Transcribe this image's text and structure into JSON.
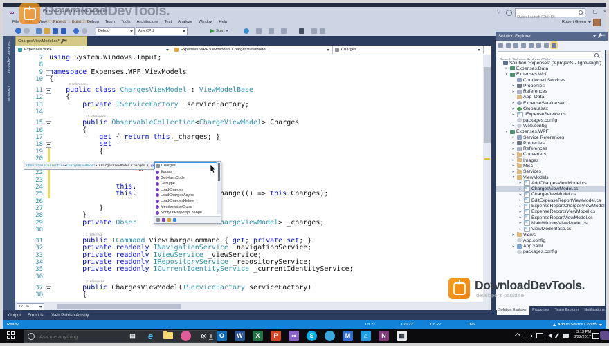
{
  "colors": {
    "accent_blue": "#1282d8",
    "keyword_blue": "#0009e8",
    "type_teal": "#2b91af",
    "tab_active": "#d6c887",
    "watermark_orange": "#f5941d"
  },
  "icons": {
    "minimize": "–",
    "restore": "▢",
    "close": "×",
    "filter": "▽",
    "vs_logo": "∞",
    "chevron_down": "▾"
  },
  "watermark": {
    "brand": "DownloadDevTools.",
    "tagline": "developer's paradise"
  },
  "titlebar": {
    "title": "Expenses - Microsoft Visual Studio",
    "quick_launch_placeholder": "Quick Launch (Ctrl+Q)",
    "user": "Robert Green"
  },
  "menubar": {
    "items": [
      "File",
      "Edit",
      "View",
      "Project",
      "Build",
      "Debug",
      "Team",
      "Tools",
      "Architecture",
      "Test",
      "Analyze",
      "Window",
      "Help"
    ]
  },
  "toolbar": {
    "debug_target": "Debug",
    "platform": "Any CPU",
    "start_label": "Start"
  },
  "left_strip": {
    "tabs": [
      "Server Explorer",
      "Toolbox"
    ]
  },
  "editor": {
    "tab": {
      "label": "ChargesViewModel.cs*"
    },
    "navbar": {
      "project": "Expenses.WPF",
      "type_path": "Expenses.WPF.ViewModels.ChargesViewModel",
      "member": "Charges"
    },
    "zoom_level": "121 %",
    "lines": [
      {
        "n": 7,
        "ind": 0,
        "tk": [
          [
            "k",
            "using"
          ],
          [
            "p",
            " System.Windows.Input;"
          ]
        ]
      },
      {
        "n": 8,
        "ind": 0,
        "tk": []
      },
      {
        "n": 9,
        "ind": 0,
        "fold": true,
        "tk": [
          [
            "k",
            "namespace"
          ],
          [
            "p",
            " Expenses.WPF.ViewModels"
          ]
        ]
      },
      {
        "n": 10,
        "ind": 0,
        "tk": [
          [
            "p",
            "{"
          ]
        ]
      },
      {
        "n": 11,
        "ind": 4,
        "fold": true,
        "lens": "5 references",
        "tk": [
          [
            "k",
            "public"
          ],
          [
            "p",
            " "
          ],
          [
            "k",
            "class"
          ],
          [
            "p",
            " "
          ],
          [
            "t",
            "ChargesViewModel"
          ],
          [
            "p",
            " : "
          ],
          [
            "t",
            "ViewModelBase"
          ]
        ]
      },
      {
        "n": 12,
        "ind": 4,
        "tk": [
          [
            "p",
            "{"
          ]
        ]
      },
      {
        "n": 13,
        "ind": 8,
        "tk": [
          [
            "k",
            "private"
          ],
          [
            "p",
            " "
          ],
          [
            "t",
            "IServiceFactory"
          ],
          [
            "p",
            " _serviceFactory;"
          ]
        ]
      },
      {
        "n": 14,
        "ind": 8,
        "tk": []
      },
      {
        "n": 15,
        "ind": 8,
        "fold": true,
        "lens": "11 references",
        "tk": [
          [
            "k",
            "public"
          ],
          [
            "p",
            " "
          ],
          [
            "t",
            "ObservableCollection"
          ],
          [
            "p",
            "<"
          ],
          [
            "t",
            "ChargeViewModel"
          ],
          [
            "p",
            "> Charges"
          ]
        ]
      },
      {
        "n": 16,
        "ind": 8,
        "tk": [
          [
            "p",
            "{"
          ]
        ]
      },
      {
        "n": 17,
        "ind": 12,
        "tk": [
          [
            "k",
            "get"
          ],
          [
            "p",
            " { "
          ],
          [
            "k",
            "return"
          ],
          [
            "p",
            " "
          ],
          [
            "k",
            "this"
          ],
          [
            "p",
            "._charges; }"
          ]
        ]
      },
      {
        "n": 18,
        "ind": 12,
        "fold": true,
        "tk": [
          [
            "k",
            "set"
          ]
        ]
      },
      {
        "n": 19,
        "ind": 12,
        "chg": true,
        "tk": [
          [
            "p",
            "{"
          ]
        ]
      },
      {
        "n": 20,
        "ind": 12,
        "chg": true,
        "tk": []
      },
      {
        "n": 21,
        "ind": 16,
        "chg": true,
        "caret": true,
        "tk": [
          [
            "k",
            "this"
          ],
          [
            "p",
            "."
          ]
        ]
      },
      {
        "n": 22,
        "ind": 16,
        "chg": true,
        "tk": []
      },
      {
        "n": 23,
        "ind": 16,
        "chg": true,
        "tk": []
      },
      {
        "n": 24,
        "ind": 16,
        "chg": true,
        "tk": [
          [
            "k",
            "this"
          ],
          [
            "p",
            "."
          ]
        ]
      },
      {
        "n": 25,
        "ind": 16,
        "chg": true,
        "tk": [
          [
            "k",
            "this"
          ],
          [
            "p",
            "."
          ],
          [
            "g",
            19
          ],
          [
            "p",
            "Change(() => "
          ],
          [
            "k",
            "this"
          ],
          [
            "p",
            ".Charges);"
          ]
        ]
      },
      {
        "n": 26,
        "ind": 16,
        "tk": []
      },
      {
        "n": 27,
        "ind": 12,
        "tk": [
          [
            "p",
            "}"
          ]
        ]
      },
      {
        "n": 28,
        "ind": 8,
        "tk": [
          [
            "p",
            "}"
          ]
        ]
      },
      {
        "n": 29,
        "ind": 8,
        "tk": [
          [
            "k",
            "private"
          ],
          [
            "p",
            " "
          ],
          [
            "t",
            "Obser"
          ],
          [
            "g",
            19
          ],
          [
            "t",
            "ChargeViewModel"
          ],
          [
            "p",
            "> _charges;"
          ]
        ]
      },
      {
        "n": 30,
        "ind": 8,
        "tk": []
      },
      {
        "n": 31,
        "ind": 8,
        "lens": "1 reference",
        "tk": [
          [
            "k",
            "public"
          ],
          [
            "p",
            " "
          ],
          [
            "t",
            "ICommand"
          ],
          [
            "p",
            " ViewChargeCommand { "
          ],
          [
            "k",
            "get"
          ],
          [
            "p",
            "; "
          ],
          [
            "k",
            "private"
          ],
          [
            "p",
            " "
          ],
          [
            "k",
            "set"
          ],
          [
            "p",
            "; }"
          ]
        ]
      },
      {
        "n": 32,
        "ind": 8,
        "tk": [
          [
            "k",
            "private"
          ],
          [
            "p",
            " "
          ],
          [
            "k",
            "readonly"
          ],
          [
            "p",
            " "
          ],
          [
            "t",
            "INavigationService"
          ],
          [
            "p",
            " _navigationService;"
          ]
        ]
      },
      {
        "n": 33,
        "ind": 8,
        "tk": [
          [
            "k",
            "private"
          ],
          [
            "p",
            " "
          ],
          [
            "k",
            "readonly"
          ],
          [
            "p",
            " "
          ],
          [
            "t",
            "IViewService"
          ],
          [
            "p",
            " _viewService;"
          ]
        ]
      },
      {
        "n": 34,
        "ind": 8,
        "tk": [
          [
            "k",
            "private"
          ],
          [
            "p",
            " "
          ],
          [
            "k",
            "readonly"
          ],
          [
            "p",
            " "
          ],
          [
            "t",
            "IRepositoryService"
          ],
          [
            "p",
            " _repositoryService;"
          ]
        ]
      },
      {
        "n": 35,
        "ind": 8,
        "tk": [
          [
            "k",
            "private"
          ],
          [
            "p",
            " "
          ],
          [
            "k",
            "readonly"
          ],
          [
            "p",
            " "
          ],
          [
            "t",
            "ICurrentIdentityService"
          ],
          [
            "p",
            " _currentIdentityService;"
          ]
        ]
      },
      {
        "n": 36,
        "ind": 8,
        "tk": []
      },
      {
        "n": 37,
        "ind": 8,
        "fold": true,
        "lens": "3 references",
        "tk": [
          [
            "k",
            "public"
          ],
          [
            "p",
            " ChargesViewModel("
          ],
          [
            "t",
            "IServiceFactory"
          ],
          [
            "p",
            " serviceFactory)"
          ]
        ]
      },
      {
        "n": 38,
        "ind": 8,
        "tk": [
          [
            "p",
            "{"
          ]
        ]
      }
    ]
  },
  "tooltip": {
    "tk": [
      [
        "t",
        "ObservableCollection"
      ],
      [
        "p",
        "<"
      ],
      [
        "t",
        "ChargeViewModel"
      ],
      [
        "p",
        "> "
      ],
      [
        "p",
        "ChargesViewModel.Charges"
      ],
      [
        "p",
        " { "
      ],
      [
        "k",
        "get"
      ],
      [
        "p",
        "; "
      ],
      [
        "k",
        "set"
      ],
      [
        "p",
        "; }"
      ]
    ]
  },
  "intellisense": {
    "selected_index": 0,
    "items": [
      {
        "label": "Charges",
        "kind": "property"
      },
      {
        "label": "Equals",
        "kind": "method"
      },
      {
        "label": "GetHashCode",
        "kind": "method"
      },
      {
        "label": "GetType",
        "kind": "method"
      },
      {
        "label": "LoadCharges",
        "kind": "method"
      },
      {
        "label": "LoadChargesAsync",
        "kind": "method"
      },
      {
        "label": "LoadChargesHelper",
        "kind": "method"
      },
      {
        "label": "MemberwiseClone",
        "kind": "method"
      },
      {
        "label": "NotifyOfPropertyChange",
        "kind": "method"
      }
    ],
    "filter_icons": [
      "properties-filter",
      "methods-filter",
      "classes-filter",
      "events-filter"
    ]
  },
  "solution_explorer": {
    "header": "Solution Explorer",
    "search_placeholder": "Search Solution Explorer (Ctrl+;)",
    "toolbar_icons": [
      {
        "name": "home"
      },
      {
        "name": "switch-views"
      },
      {
        "name": "pending-changes-filter"
      },
      {
        "name": "refresh"
      },
      {
        "name": "collapse-all"
      },
      {
        "name": "properties"
      },
      {
        "name": "show-all-files"
      },
      {
        "name": "sync-with-active-document",
        "hl": true
      }
    ],
    "tree": [
      {
        "lvl": 0,
        "icon": "solution",
        "label": "Solution 'Expenses' (3 projects - lightweight)"
      },
      {
        "lvl": 1,
        "exp": "▸",
        "icon": "proj",
        "label": "Expenses.Data"
      },
      {
        "lvl": 1,
        "exp": "▾",
        "icon": "proj",
        "label": "Expenses.Wcf"
      },
      {
        "lvl": 2,
        "icon": "conn",
        "label": "Connected Services"
      },
      {
        "lvl": 2,
        "exp": "▸",
        "icon": "props",
        "label": "Properties"
      },
      {
        "lvl": 2,
        "exp": "▸",
        "icon": "refs",
        "label": "References"
      },
      {
        "lvl": 2,
        "icon": "folder",
        "label": "App_Data"
      },
      {
        "lvl": 2,
        "exp": "▸",
        "icon": "svc",
        "label": "ExpenseService.svc"
      },
      {
        "lvl": 2,
        "exp": "▸",
        "icon": "globe",
        "label": "Global.asax"
      },
      {
        "lvl": 2,
        "exp": "▸",
        "icon": "cs",
        "label": "IExpenseService.cs"
      },
      {
        "lvl": 2,
        "icon": "cfg",
        "label": "packages.config"
      },
      {
        "lvl": 2,
        "exp": "▸",
        "icon": "cfg",
        "label": "Web.config"
      },
      {
        "lvl": 1,
        "exp": "▾",
        "icon": "proj",
        "label": "Expenses.WPF"
      },
      {
        "lvl": 2,
        "exp": "▸",
        "icon": "conn",
        "label": "Service References"
      },
      {
        "lvl": 2,
        "exp": "▸",
        "icon": "props",
        "label": "Properties"
      },
      {
        "lvl": 2,
        "exp": "▸",
        "icon": "refs",
        "label": "References"
      },
      {
        "lvl": 2,
        "exp": "▸",
        "icon": "folder",
        "label": "Converters"
      },
      {
        "lvl": 2,
        "exp": "▸",
        "icon": "folder",
        "label": "Images"
      },
      {
        "lvl": 2,
        "exp": "▸",
        "icon": "folder",
        "label": "Misc"
      },
      {
        "lvl": 2,
        "exp": "▸",
        "icon": "folder",
        "label": "Services"
      },
      {
        "lvl": 2,
        "exp": "▾",
        "icon": "folder",
        "label": "ViewModels"
      },
      {
        "lvl": 3,
        "exp": "▸",
        "icon": "cs",
        "label": "AddChargesViewModel.cs"
      },
      {
        "lvl": 3,
        "exp": "▸",
        "icon": "cs",
        "label": "ChargesViewModel.cs",
        "sel": true
      },
      {
        "lvl": 3,
        "exp": "▸",
        "icon": "cs",
        "label": "ChargeViewModel.cs"
      },
      {
        "lvl": 3,
        "exp": "▸",
        "icon": "cs",
        "label": "EditExpenseReportViewModel.cs"
      },
      {
        "lvl": 3,
        "exp": "▸",
        "icon": "cs",
        "label": "ExpenseReportChargesViewModel.cs"
      },
      {
        "lvl": 3,
        "exp": "▸",
        "icon": "cs",
        "label": "ExpenseReportsViewModel.cs"
      },
      {
        "lvl": 3,
        "exp": "▸",
        "icon": "cs",
        "label": "ExpenseReportViewModel.cs"
      },
      {
        "lvl": 3,
        "exp": "▸",
        "icon": "cs",
        "label": "MainWindowViewModel.cs"
      },
      {
        "lvl": 3,
        "exp": "▸",
        "icon": "cs",
        "label": "ViewModelBase.cs"
      },
      {
        "lvl": 2,
        "exp": "▸",
        "icon": "folder",
        "label": "Views"
      },
      {
        "lvl": 2,
        "icon": "cfg",
        "label": "App.config"
      },
      {
        "lvl": 2,
        "exp": "▸",
        "icon": "xaml",
        "label": "App.xaml"
      },
      {
        "lvl": 2,
        "icon": "cfg",
        "label": "packages.config"
      }
    ]
  },
  "right_panel": {
    "tabs": [
      "Solution Explorer",
      "Properties",
      "Team Explorer",
      "Notifications"
    ],
    "active_tab": 0
  },
  "bottom_panel": {
    "tabs": [
      "Output",
      "Error List",
      "Web Publish Activity"
    ]
  },
  "status_bar": {
    "ready": "Ready",
    "ln": "Ln 21",
    "col": "Col 22",
    "ch": "Ch 22",
    "mode": "INS",
    "source_control": "Add to Source Control"
  },
  "taskbar": {
    "search_placeholder": "Ask me anything",
    "time": "3:13 PM",
    "date": "3/22/2017",
    "icons": [
      {
        "name": "task-view",
        "kind": "glyph",
        "glyph": "▤",
        "fg": "#e8e8e8"
      },
      {
        "name": "edge",
        "kind": "glyph",
        "glyph": "e",
        "fg": "#45c5f5"
      },
      {
        "name": "file-explorer",
        "kind": "folder"
      },
      {
        "name": "photos-app",
        "kind": "circle",
        "bg": "#e05c97"
      },
      {
        "name": "camera-app",
        "kind": "glyph",
        "glyph": "◎",
        "fg": "#f0f0f0"
      },
      {
        "name": "outlook",
        "kind": "tile",
        "bg": "#0f6cbd",
        "glyph": "O"
      },
      {
        "name": "word",
        "kind": "tile",
        "bg": "#2b579a",
        "glyph": "W"
      },
      {
        "name": "excel",
        "kind": "tile",
        "bg": "#217346",
        "glyph": "X"
      },
      {
        "name": "powerpoint",
        "kind": "tile",
        "bg": "#d24726",
        "glyph": "P"
      },
      {
        "name": "visual-studio",
        "kind": "tile",
        "bg": "#8a63c9",
        "glyph": "∞"
      },
      {
        "name": "skype",
        "kind": "circle",
        "bg": "#00aff0",
        "glyph": "S"
      },
      {
        "name": "paint",
        "kind": "circle",
        "bg": "#3aa7e0"
      },
      {
        "name": "mail",
        "kind": "tile",
        "bg": "#2f6fd0",
        "glyph": "M"
      },
      {
        "name": "store",
        "kind": "tile",
        "bg": "#1ba1e2",
        "glyph": "⌂"
      },
      {
        "name": "onenote",
        "kind": "tile",
        "bg": "#80397b",
        "glyph": "N"
      },
      {
        "name": "calculator",
        "kind": "tile",
        "bg": "#e8eaed",
        "fg": "#333a44",
        "glyph": "▦"
      }
    ]
  }
}
